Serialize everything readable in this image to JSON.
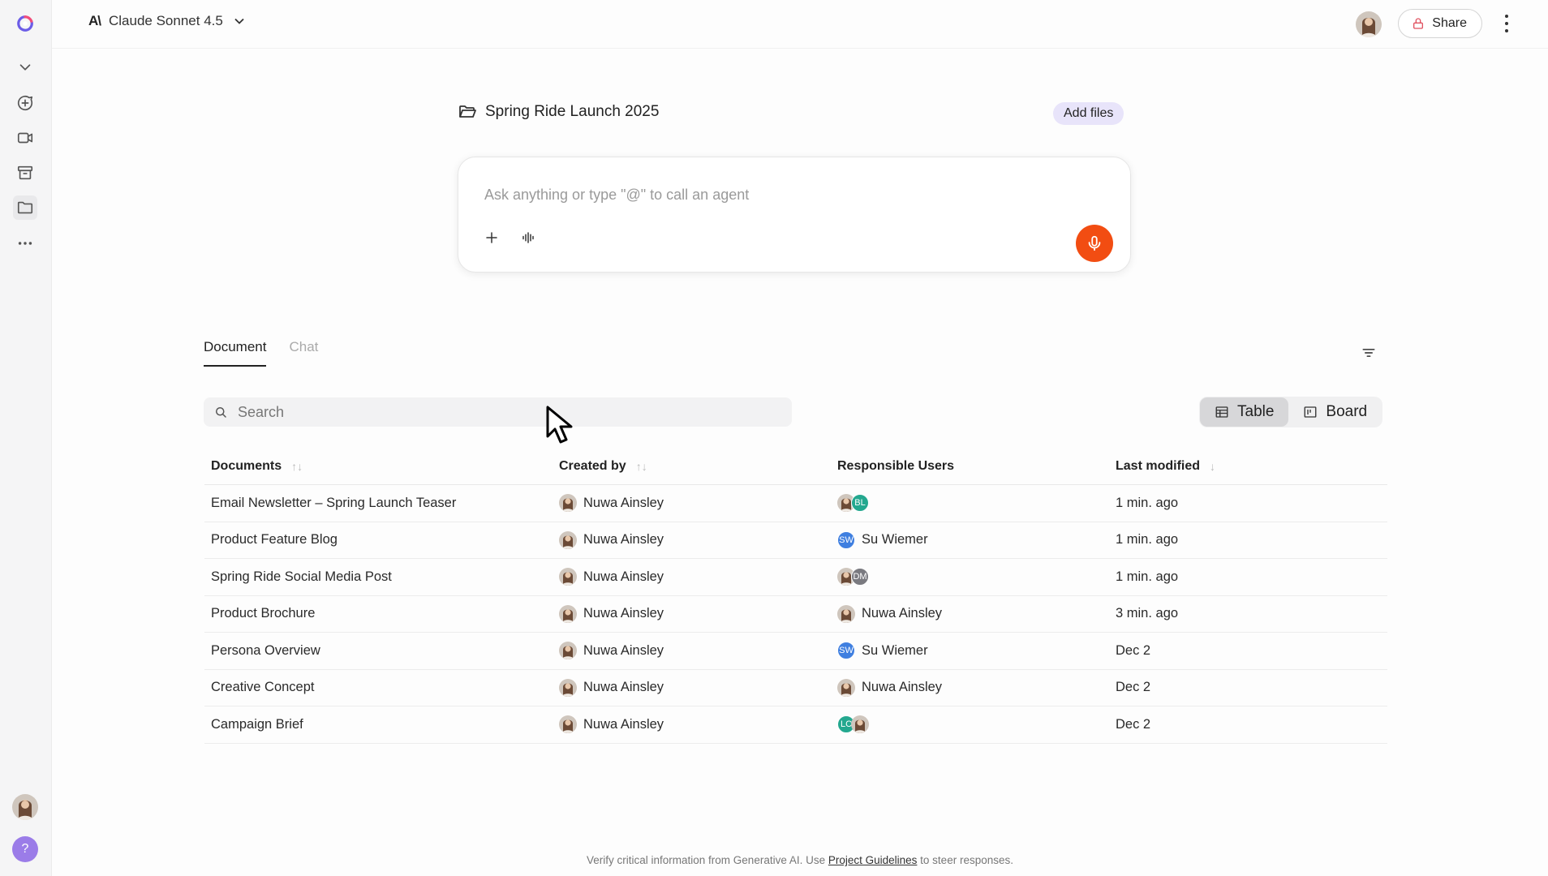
{
  "colors": {
    "accent_mic": "#f24d12",
    "add_files_bg": "#e8e4fa",
    "help_button": "#9b7ce8",
    "share_lock": "#e05260"
  },
  "rail": {
    "icons": [
      "app-logo-icon",
      "chevron-down-icon",
      "new-chat-icon",
      "video-icon",
      "archive-icon",
      "folder-icon",
      "more-icon",
      "user-avatar",
      "help-icon"
    ],
    "help_label": "?"
  },
  "header": {
    "model_logo": "A\\",
    "model_name": "Claude Sonnet 4.5",
    "share_label": "Share"
  },
  "project": {
    "title": "Spring Ride Launch 2025",
    "add_files_label": "Add files"
  },
  "prompt": {
    "placeholder": "Ask anything or type \"@\" to call an agent"
  },
  "tabs": [
    {
      "label": "Document",
      "active": true
    },
    {
      "label": "Chat",
      "active": false
    }
  ],
  "search": {
    "placeholder": "Search"
  },
  "view_toggle": {
    "table_label": "Table",
    "board_label": "Board",
    "selected": "Table"
  },
  "table": {
    "columns": [
      "Documents",
      "Created by",
      "Responsible Users",
      "Last modified"
    ],
    "sort_icons": [
      "↑↓",
      "↑↓",
      "",
      "↓"
    ],
    "rows": [
      {
        "document": "Email Newsletter – Spring Launch Teaser",
        "created_by": "Nuwa Ainsley",
        "responsible": {
          "name": "",
          "avatars": [
            "photo",
            "BL"
          ]
        },
        "modified": "1 min. ago"
      },
      {
        "document": "Product Feature Blog",
        "created_by": "Nuwa Ainsley",
        "responsible": {
          "name": "Su Wiemer",
          "avatars": [
            "SW"
          ]
        },
        "modified": "1 min. ago"
      },
      {
        "document": "Spring Ride Social Media Post",
        "created_by": "Nuwa Ainsley",
        "responsible": {
          "name": "",
          "avatars": [
            "photo",
            "DM"
          ]
        },
        "modified": "1 min. ago"
      },
      {
        "document": "Product Brochure",
        "created_by": "Nuwa Ainsley",
        "responsible": {
          "name": "Nuwa Ainsley",
          "avatars": [
            "photo"
          ]
        },
        "modified": "3 min. ago"
      },
      {
        "document": "Persona Overview",
        "created_by": "Nuwa Ainsley",
        "responsible": {
          "name": "Su Wiemer",
          "avatars": [
            "SW"
          ]
        },
        "modified": "Dec 2"
      },
      {
        "document": "Creative Concept",
        "created_by": "Nuwa Ainsley",
        "responsible": {
          "name": "Nuwa Ainsley",
          "avatars": [
            "photo"
          ]
        },
        "modified": "Dec 2"
      },
      {
        "document": "Campaign Brief",
        "created_by": "Nuwa Ainsley",
        "responsible": {
          "name": "",
          "avatars": [
            "LC",
            "photo"
          ]
        },
        "modified": "Dec 2"
      }
    ]
  },
  "footer": {
    "text_before": "Verify critical information from Generative AI. Use ",
    "link": "Project Guidelines",
    "text_after": " to steer responses."
  }
}
